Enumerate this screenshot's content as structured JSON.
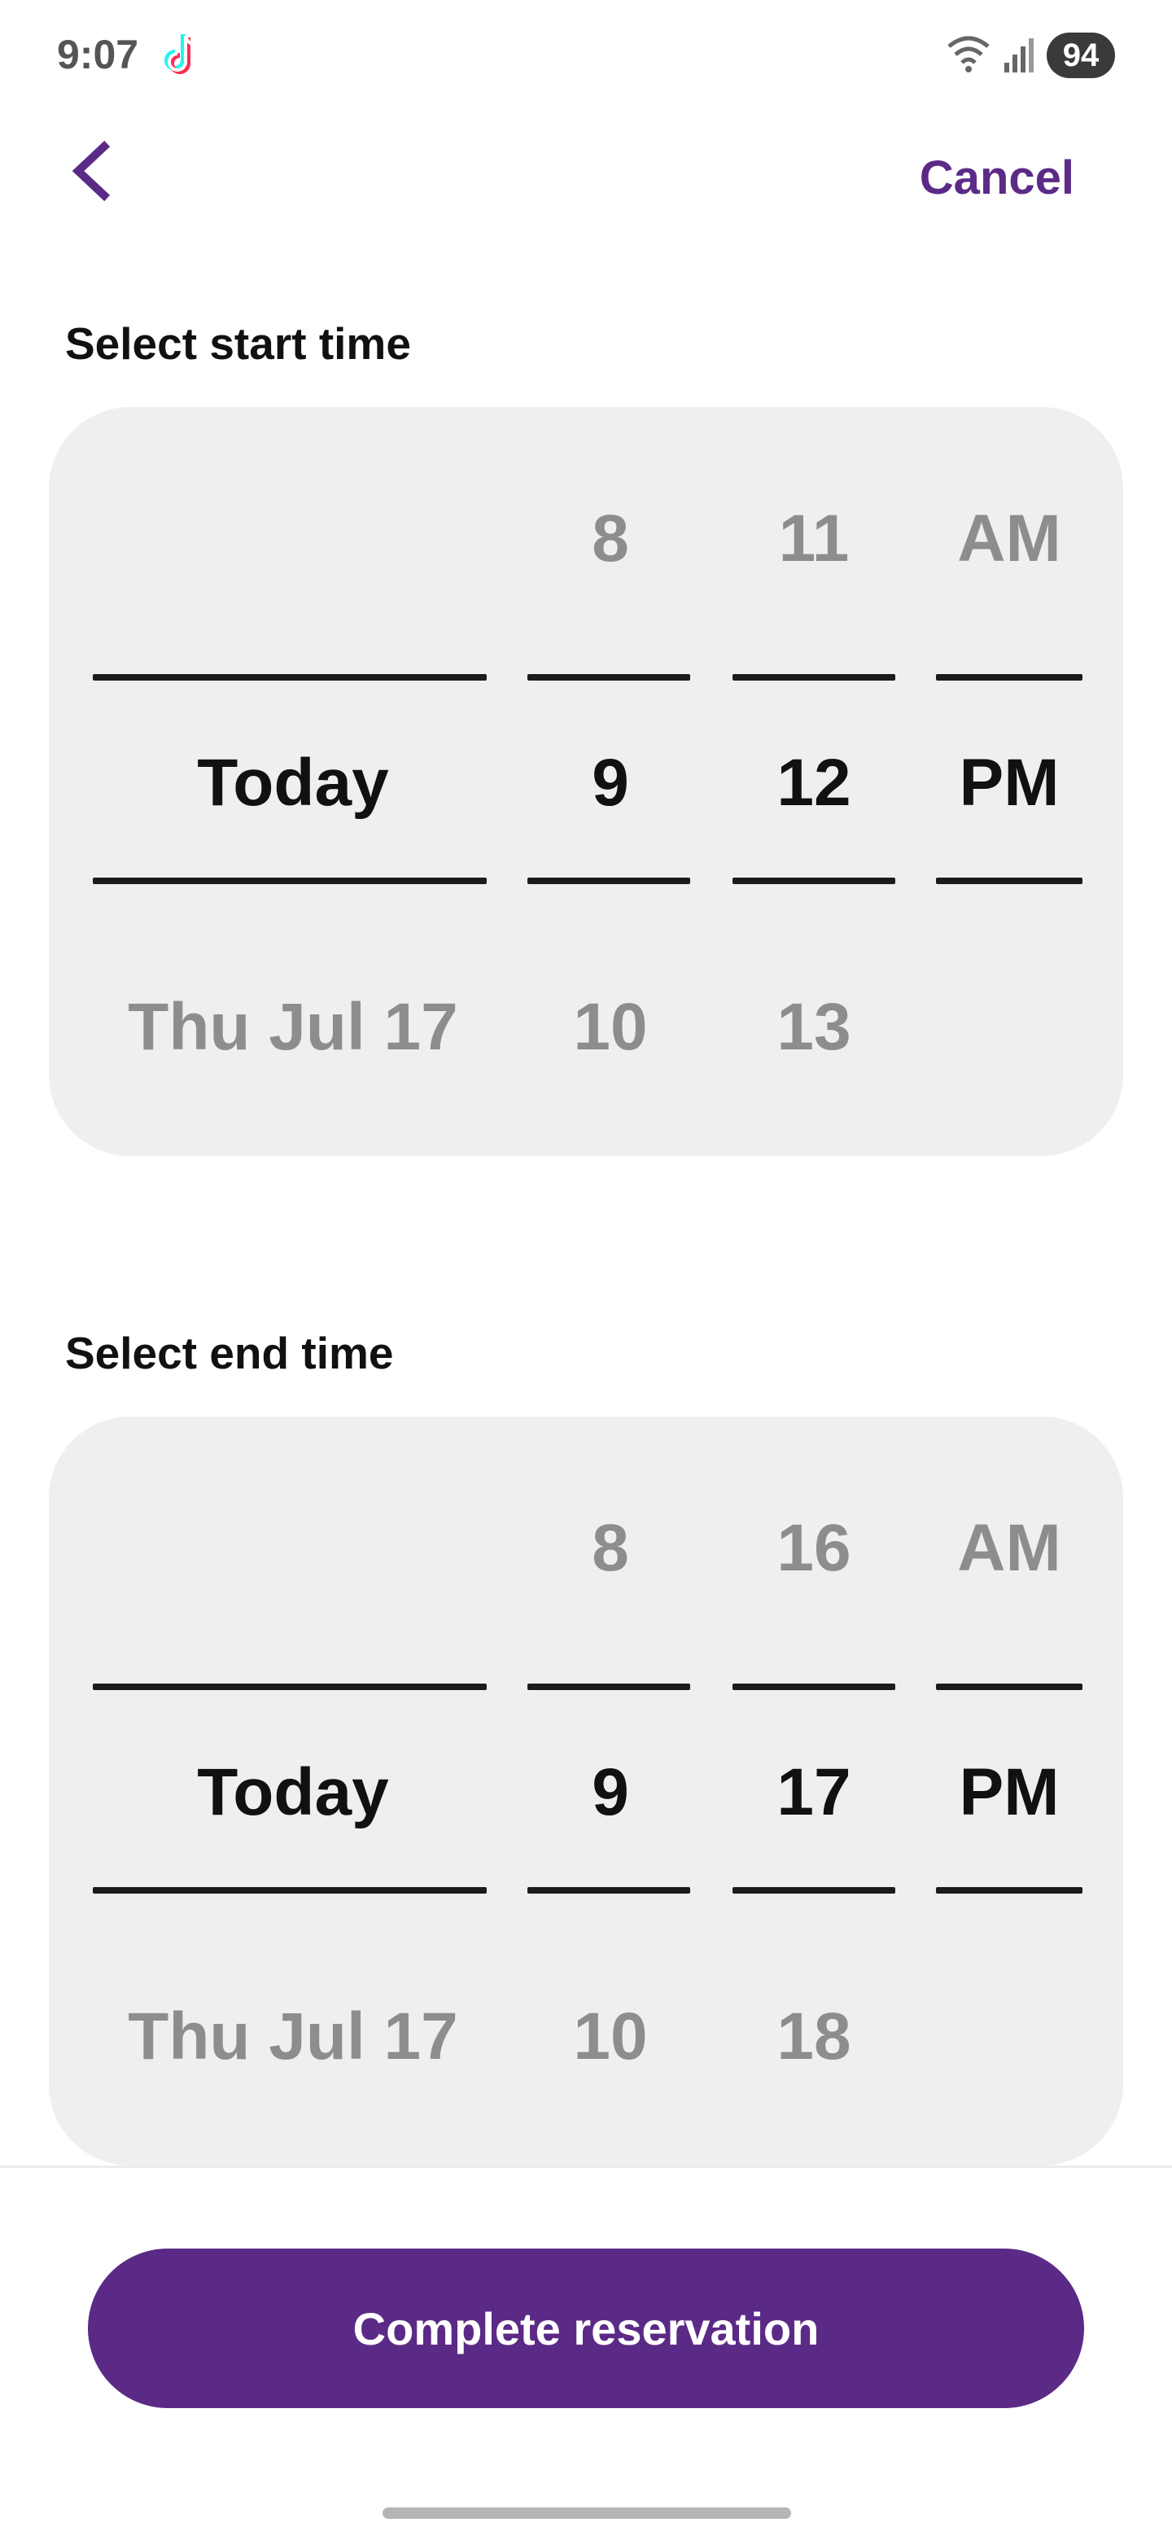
{
  "status_bar": {
    "time": "9:07",
    "battery": "94",
    "icons": [
      "tiktok-icon",
      "wifi-icon",
      "signal-icon",
      "battery-icon"
    ]
  },
  "header": {
    "cancel_label": "Cancel"
  },
  "start": {
    "label": "Select start time",
    "day": {
      "above": "",
      "selected": "Today",
      "below": "Thu Jul 17"
    },
    "hour": {
      "above": "8",
      "selected": "9",
      "below": "10"
    },
    "minute": {
      "above": "11",
      "selected": "12",
      "below": "13"
    },
    "ampm": {
      "above": "AM",
      "selected": "PM",
      "below": ""
    }
  },
  "end": {
    "label": "Select end time",
    "day": {
      "above": "",
      "selected": "Today",
      "below": "Thu Jul 17"
    },
    "hour": {
      "above": "8",
      "selected": "9",
      "below": "10"
    },
    "minute": {
      "above": "16",
      "selected": "17",
      "below": "18"
    },
    "ampm": {
      "above": "AM",
      "selected": "PM",
      "below": ""
    }
  },
  "footer": {
    "complete_label": "Complete reservation"
  },
  "colors": {
    "accent": "#5b2a86",
    "picker_bg": "#efefef",
    "dim_text": "#8d8d8d"
  }
}
